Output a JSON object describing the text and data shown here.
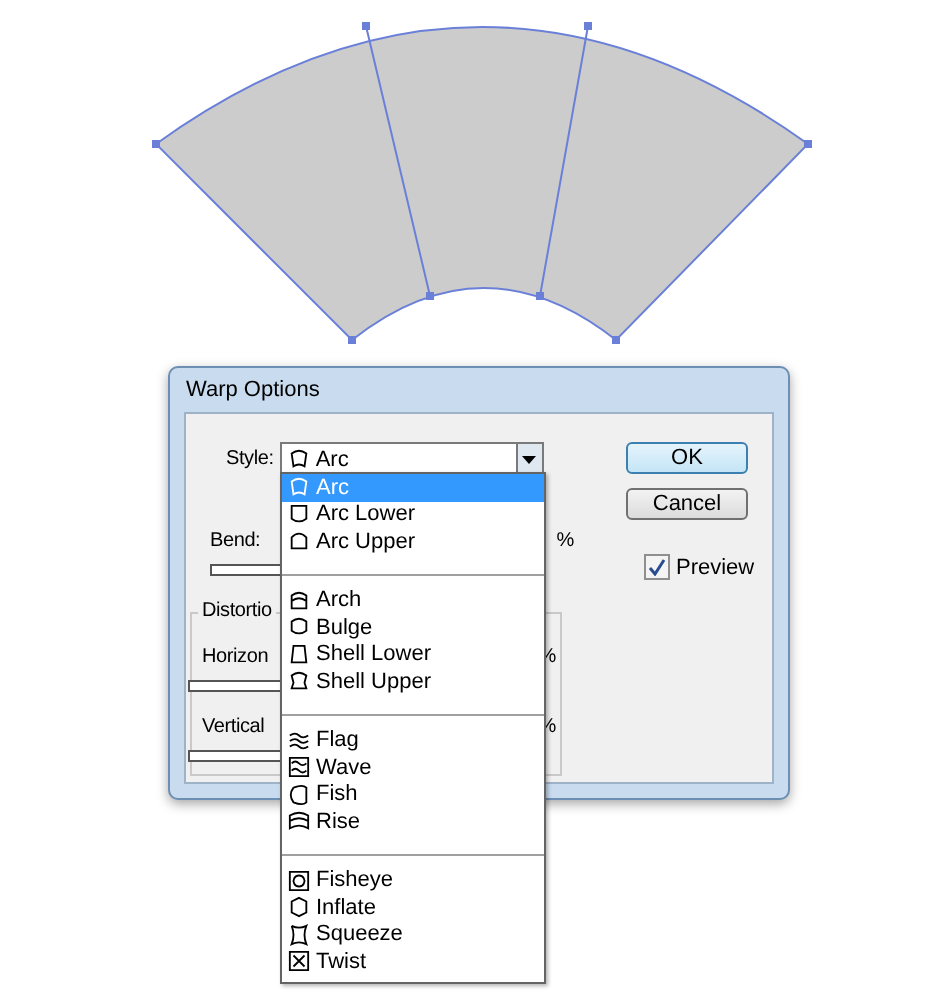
{
  "window": {
    "title": "Warp Options"
  },
  "style": {
    "label": "Style:",
    "value": "Arc"
  },
  "bend": {
    "label": "Bend:",
    "unit": "%"
  },
  "distortion": {
    "title": "Distortio",
    "rows": [
      {
        "label": "Horizon",
        "unit": "%"
      },
      {
        "label": "Vertical",
        "unit": "%"
      }
    ]
  },
  "buttons": [
    {
      "label": "OK",
      "default": true
    },
    {
      "label": "Cancel",
      "default": false
    }
  ],
  "preview": {
    "label": "Preview",
    "checked": true
  },
  "dropdown": {
    "groups": [
      [
        {
          "label": "Arc",
          "selected": true
        },
        {
          "label": "Arc Lower",
          "selected": false
        },
        {
          "label": "Arc Upper",
          "selected": false
        }
      ],
      [
        {
          "label": "Arch",
          "selected": false
        },
        {
          "label": "Bulge",
          "selected": false
        },
        {
          "label": "Shell Lower",
          "selected": false
        },
        {
          "label": "Shell Upper",
          "selected": false
        }
      ],
      [
        {
          "label": "Flag",
          "selected": false
        },
        {
          "label": "Wave",
          "selected": false
        },
        {
          "label": "Fish",
          "selected": false
        },
        {
          "label": "Rise",
          "selected": false
        }
      ],
      [
        {
          "label": "Fisheye",
          "selected": false
        },
        {
          "label": "Inflate",
          "selected": false
        },
        {
          "label": "Squeeze",
          "selected": false
        },
        {
          "label": "Twist",
          "selected": false
        }
      ]
    ]
  }
}
